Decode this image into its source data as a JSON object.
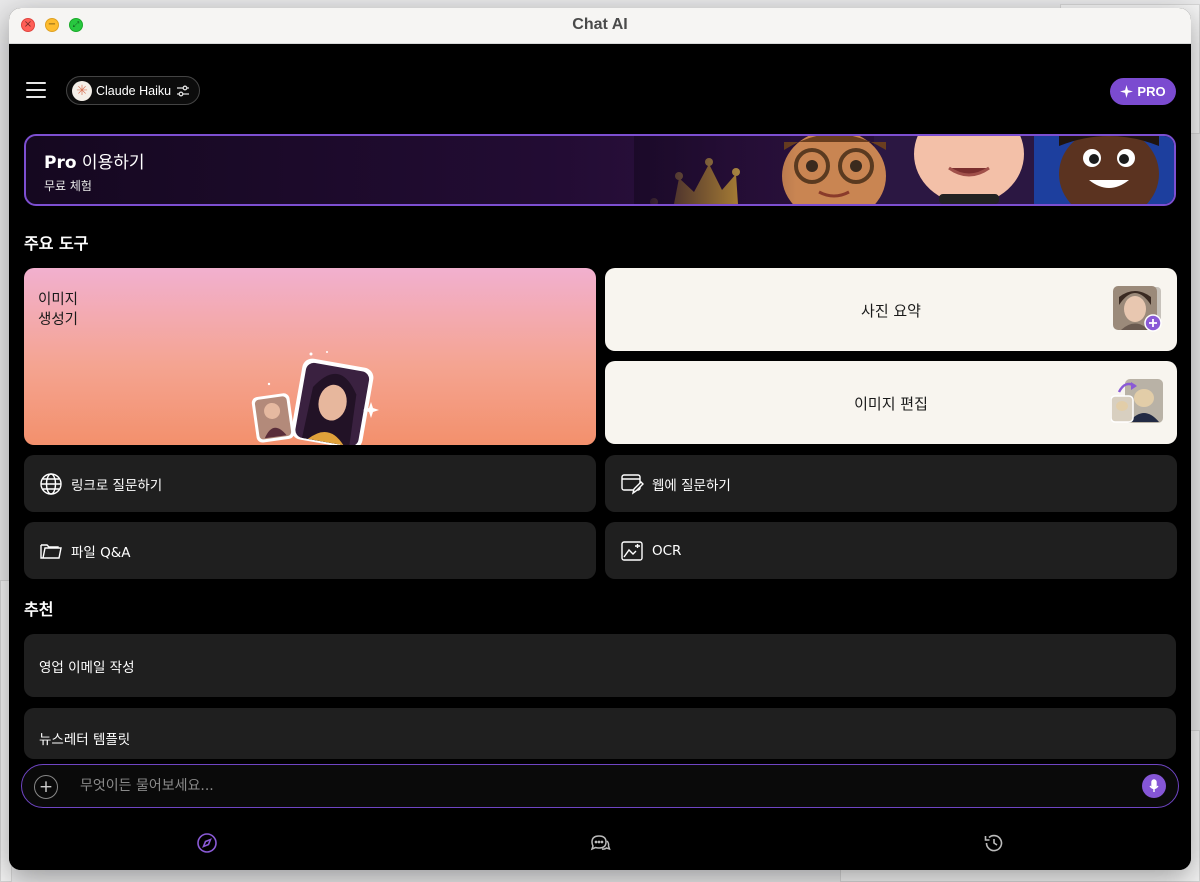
{
  "window": {
    "title": "Chat AI"
  },
  "header": {
    "model_name": "Claude Haiku",
    "pro_label": "PRO"
  },
  "banner": {
    "title_bold": "Pro",
    "title_rest": " 이용하기",
    "subtitle": "무료 체험"
  },
  "tools": {
    "section_title": "주요 도구",
    "image_generator": "이미지\n생성기",
    "photo_summary": "사진 요약",
    "image_edit": "이미지 편집",
    "ask_link": "링크로 질문하기",
    "ask_web": "웹에 질문하기",
    "file_qa": "파일 Q&A",
    "ocr": "OCR"
  },
  "recommend": {
    "section_title": "추천",
    "items": [
      "영업 이메일 작성",
      "뉴스레터 템플릿"
    ]
  },
  "input": {
    "placeholder": "무엇이든 물어보세요..."
  },
  "colors": {
    "accent": "#7b4bd0",
    "card_dark": "#1f1f1f",
    "card_light": "#f8f5ef"
  },
  "icons": {
    "menu": "hamburger-icon",
    "settings": "sliders-icon",
    "pro": "sparkle-icon",
    "link": "globe-icon",
    "web": "browser-edit-icon",
    "file": "folder-icon",
    "ocr": "image-scan-icon",
    "mic": "microphone-icon",
    "tabs": [
      "compass-icon",
      "chat-bubbles-icon",
      "history-icon"
    ]
  }
}
